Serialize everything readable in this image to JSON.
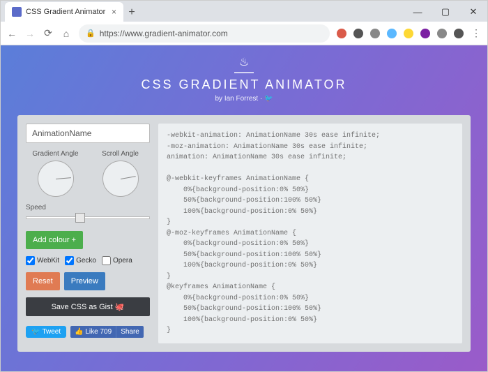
{
  "chrome": {
    "tab_title": "CSS Gradient Animator",
    "new_tab": "+",
    "win": {
      "min": "—",
      "max": "▢",
      "close": "✕"
    },
    "nav": {
      "back": "←",
      "fwd": "→",
      "reload": "⟳",
      "home": "⌂"
    },
    "lock": "🔒",
    "url": "https://www.gradient-animator.com",
    "ext_colors": [
      "#da5b4a",
      "#555",
      "#888",
      "#5bb8ff",
      "#fdd835",
      "#7b1fa2",
      "#888",
      "#555"
    ],
    "menu": "⋮"
  },
  "hero": {
    "flame": "♨",
    "title": "CSS GRADIENT ANIMATOR",
    "byline_pre": "by ",
    "author": "Ian Forrest",
    "sep": " · ",
    "tw": "🐦"
  },
  "controls": {
    "name_value": "AnimationName",
    "angle1_label": "Gradient Angle",
    "angle2_label": "Scroll Angle",
    "speed_label": "Speed",
    "add_colour": "Add colour +",
    "prefixes": {
      "webkit": {
        "label": "WebKit",
        "checked": true
      },
      "gecko": {
        "label": "Gecko",
        "checked": true
      },
      "opera": {
        "label": "Opera",
        "checked": false
      }
    },
    "reset": "Reset",
    "preview": "Preview",
    "gist_pre": "Save CSS as Gist ",
    "gist_icon": "🐙",
    "tweet": "Tweet",
    "like": "Like 709",
    "share": "Share"
  },
  "code": "-webkit-animation: AnimationName 30s ease infinite;\n-moz-animation: AnimationName 30s ease infinite;\nanimation: AnimationName 30s ease infinite;\n\n@-webkit-keyframes AnimationName {\n    0%{background-position:0% 50%}\n    50%{background-position:100% 50%}\n    100%{background-position:0% 50%}\n}\n@-moz-keyframes AnimationName {\n    0%{background-position:0% 50%}\n    50%{background-position:100% 50%}\n    100%{background-position:0% 50%}\n}\n@keyframes AnimationName {\n    0%{background-position:0% 50%}\n    50%{background-position:100% 50%}\n    100%{background-position:0% 50%}\n}"
}
